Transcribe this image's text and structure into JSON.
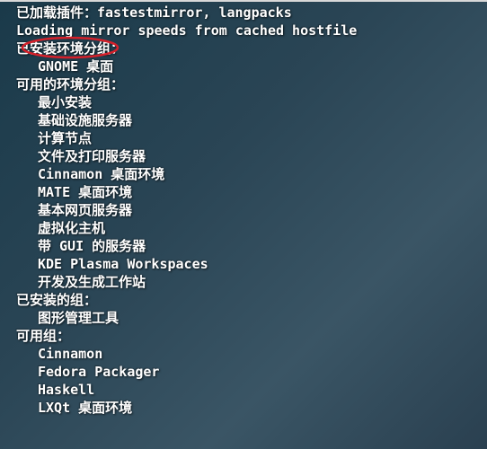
{
  "lines": {
    "l0": "已加载插件：fastestmirror, langpacks",
    "l1": "Loading mirror speeds from cached hostfile",
    "l2": "已安装环境分组：",
    "l3": "GNOME 桌面",
    "l4": "可用的环境分组：",
    "l5": "最小安装",
    "l6": "基础设施服务器",
    "l7": "计算节点",
    "l8": "文件及打印服务器",
    "l9": "Cinnamon 桌面环境",
    "l10": "MATE 桌面环境",
    "l11": "基本网页服务器",
    "l12": "虚拟化主机",
    "l13": "带 GUI 的服务器",
    "l14": "KDE Plasma Workspaces",
    "l15": "开发及生成工作站",
    "l16": "已安装的组：",
    "l17": "图形管理工具",
    "l18": "可用组：",
    "l19": "Cinnamon",
    "l20": "Fedora Packager",
    "l21": "Haskell",
    "l22": "LXQt 桌面环境"
  },
  "annotation": {
    "color": "#d4202a"
  }
}
